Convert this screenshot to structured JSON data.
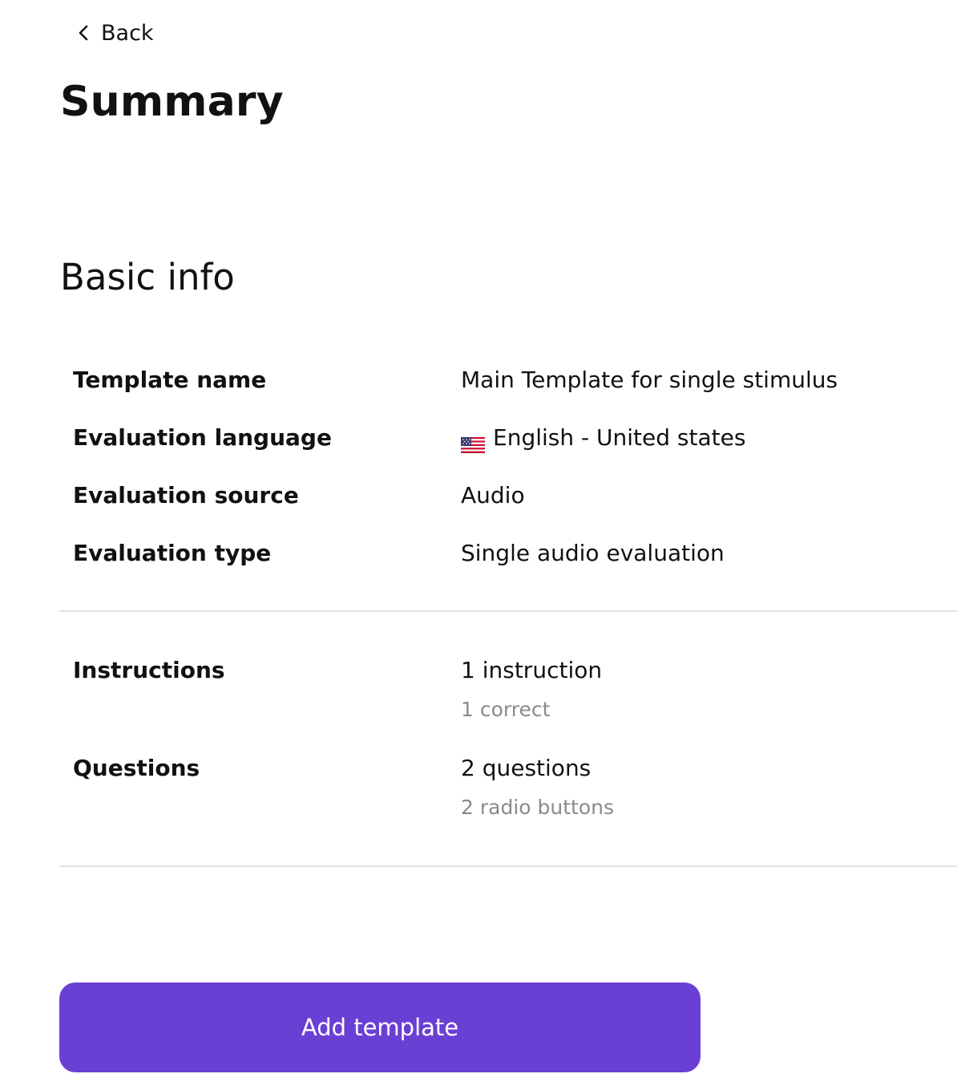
{
  "nav": {
    "back_label": "Back"
  },
  "page": {
    "title": "Summary"
  },
  "basic_info": {
    "heading": "Basic info",
    "rows": [
      {
        "label": "Template name",
        "value": "Main Template for single stimulus"
      },
      {
        "label": "Evaluation language",
        "value": "English - United states",
        "flag_icon": "us-flag-icon"
      },
      {
        "label": "Evaluation source",
        "value": "Audio"
      },
      {
        "label": "Evaluation type",
        "value": "Single audio evaluation"
      }
    ]
  },
  "content": {
    "rows": [
      {
        "label": "Instructions",
        "value": "1 instruction",
        "detail": "1 correct"
      },
      {
        "label": "Questions",
        "value": "2 questions",
        "detail": "2 radio buttons"
      }
    ]
  },
  "actions": {
    "primary_label": "Add template"
  },
  "colors": {
    "primary": "#6a3fd4",
    "divider": "#e3e3e3",
    "muted_text": "#8a8a8a",
    "text": "#111111"
  }
}
